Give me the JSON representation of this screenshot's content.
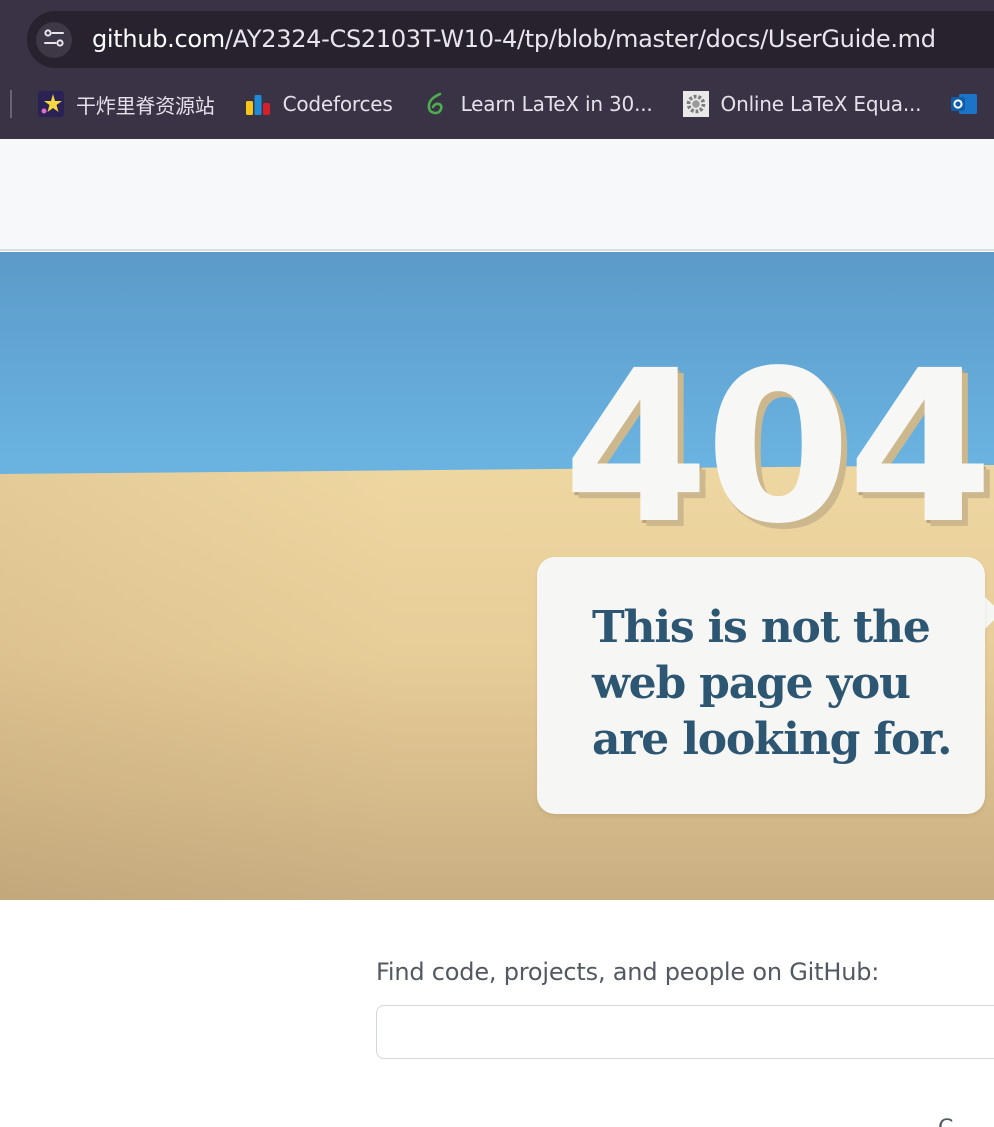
{
  "browser": {
    "url_host": "github.com",
    "url_path": "/AY2324-CS2103T-W10-4/tp/blob/master/docs/UserGuide.md",
    "site_info_icon": "tune-icon",
    "bookmarks": [
      {
        "label": "干炸里脊资源站",
        "icon": "star-sparkle-icon"
      },
      {
        "label": "Codeforces",
        "icon": "codeforces-bars-icon"
      },
      {
        "label": "Learn LaTeX in 30...",
        "icon": "overleaf-leaf-icon"
      },
      {
        "label": "Online LaTeX Equa...",
        "icon": "gear-icon"
      },
      {
        "label": "",
        "icon": "outlook-icon"
      }
    ]
  },
  "error": {
    "code": "404",
    "message_line1": "This is not the",
    "message_line2": "web page you",
    "message_line3": "are looking for."
  },
  "search": {
    "label": "Find code, projects, and people on GitHub:",
    "value": "",
    "placeholder": ""
  },
  "footer": {
    "partial_text": "C"
  },
  "colors": {
    "chrome_bg": "#3a3346",
    "omnibox_bg": "#28222f",
    "sky": "#6cb6e4",
    "sand": "#ecd5a1",
    "bubble_text": "#2d5672"
  }
}
